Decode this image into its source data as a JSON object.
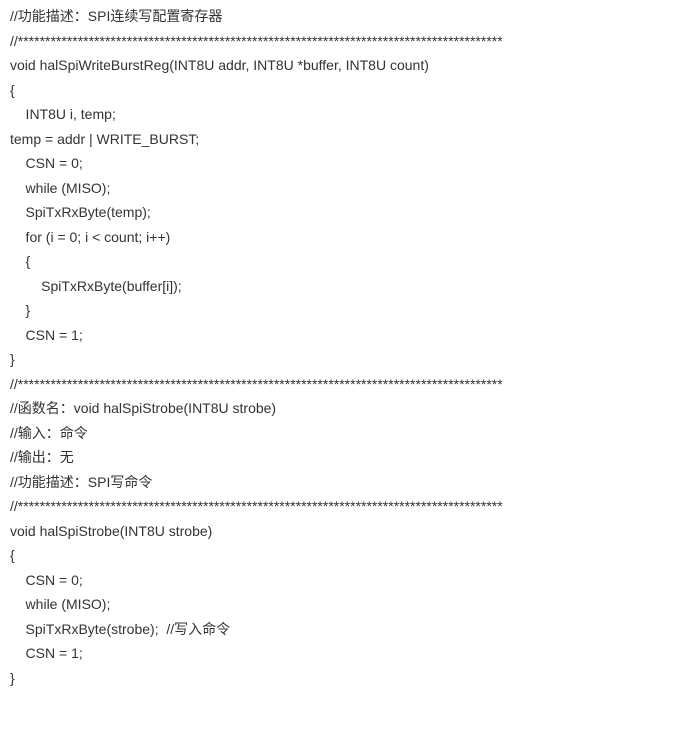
{
  "lines": [
    "//功能描述：SPI连续写配置寄存器",
    "//*****************************************************************************************",
    "void halSpiWriteBurstReg(INT8U addr, INT8U *buffer, INT8U count)",
    "{",
    "    INT8U i, temp;",
    "temp = addr | WRITE_BURST;",
    "    CSN = 0;",
    "    while (MISO);",
    "    SpiTxRxByte(temp);",
    "    for (i = 0; i < count; i++)",
    "    {",
    "        SpiTxRxByte(buffer[i]);",
    "    }",
    "    CSN = 1;",
    "}",
    "//*****************************************************************************************",
    "//函数名：void halSpiStrobe(INT8U strobe)",
    "//输入：命令",
    "//输出：无",
    "//功能描述：SPI写命令",
    "//*****************************************************************************************",
    "void halSpiStrobe(INT8U strobe)",
    "{",
    "    CSN = 0;",
    "    while (MISO);",
    "    SpiTxRxByte(strobe);  //写入命令",
    "    CSN = 1;",
    "}"
  ]
}
